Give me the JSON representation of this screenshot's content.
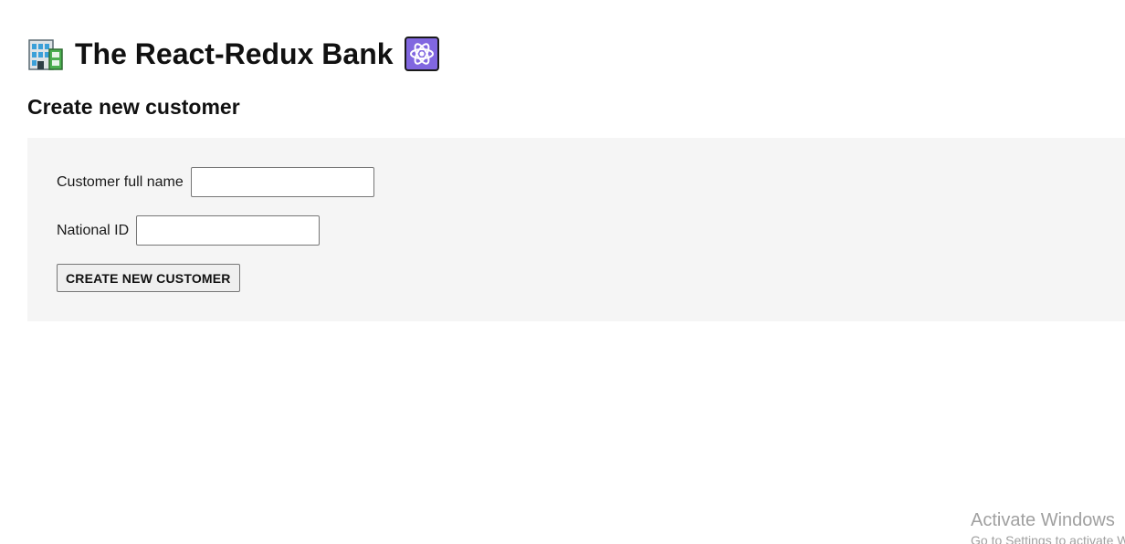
{
  "header": {
    "title": "The React-Redux Bank",
    "leading_icon": "office-building-icon",
    "trailing_icon": "atom-icon"
  },
  "section": {
    "title": "Create new customer"
  },
  "form": {
    "full_name_label": "Customer full name",
    "full_name_value": "",
    "national_id_label": "National ID",
    "national_id_value": "",
    "submit_label": "CREATE NEW CUSTOMER"
  },
  "watermark": {
    "title": "Activate Windows",
    "subtitle": "Go to Settings to activate Windows."
  },
  "colors": {
    "panel_background": "#f5f5f5",
    "atom_badge": "#8167e0",
    "text": "#111111"
  }
}
